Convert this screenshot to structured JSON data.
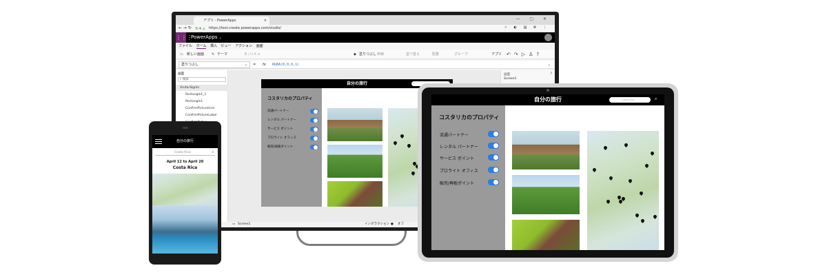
{
  "browser": {
    "tab_title": "アプリ - PowerApps",
    "security": "セキュ",
    "url": "https://test.create.powerapps.com/studio/"
  },
  "studio": {
    "brand": "PowerApps",
    "menu": [
      "ファイル",
      "ホーム",
      "挿入",
      "ビュー",
      "アクション",
      "画面"
    ],
    "menu_active": "ホーム",
    "ribbon": {
      "new_screen": "新しい画面",
      "theme": "テーマ",
      "fill": "塗りつぶし",
      "border": "枠線",
      "reorder": "並べ替え",
      "align": "配置",
      "group": "グループ",
      "app": "アプリ"
    },
    "formula": {
      "property": "塗りつぶし",
      "equals": "=",
      "fx": "fx",
      "expression": "RGBA(0,0,0,1)"
    },
    "tree": {
      "title": "画面",
      "search": "検索",
      "items": [
        "VisitorSignIn",
        "Rectangle1_1",
        "Rectangle1",
        "ConfirmPictureIcon",
        "ConfirmPictureLabel",
        "ConfirmPictur..."
      ]
    },
    "props": {
      "title": "画面",
      "screen": "Screen1"
    },
    "status": {
      "screen": "Screen1",
      "interaction": "インタラクション",
      "off": "オフ"
    }
  },
  "app": {
    "header_title": "自分の旅行",
    "search_placeholder": "Costa Rica",
    "sidebar_title": "コスタリカのプロパティ",
    "filters": [
      {
        "label": "流通パートナー",
        "on": true
      },
      {
        "label": "レンタル パートナー",
        "on": true
      },
      {
        "label": "サービス ポイント",
        "on": true
      },
      {
        "label": "プロライト オフィス",
        "on": true
      },
      {
        "label": "販売/再販ポイント",
        "on": true
      }
    ]
  },
  "phone": {
    "header_title": "自分の旅行",
    "search_text": "Costa Rica",
    "dates": "April 12 to April 20",
    "destination": "Costa Rica"
  },
  "colors": {
    "accent": "#2f7de1",
    "powerapps_purple": "#742774",
    "sidebar_gray": "#9a9a9a"
  }
}
